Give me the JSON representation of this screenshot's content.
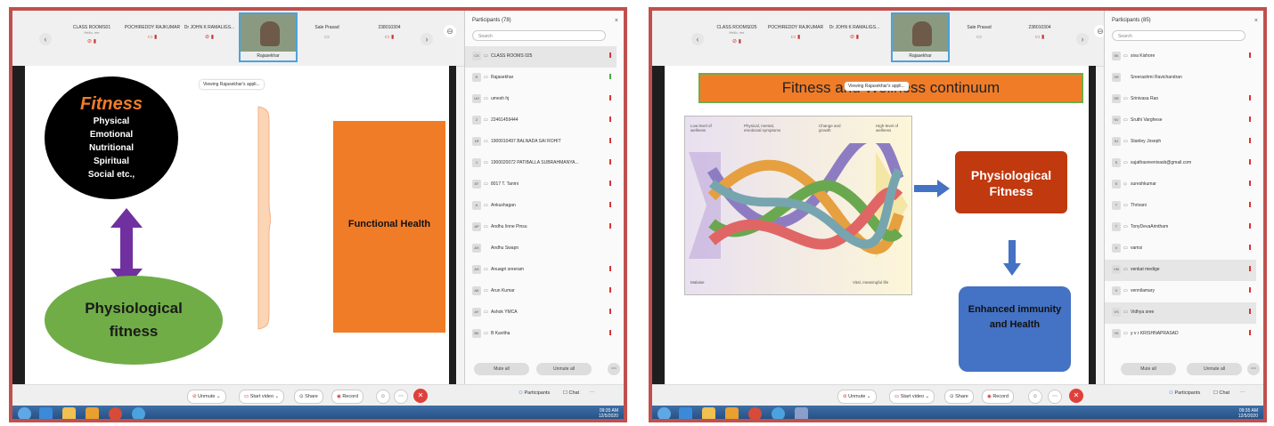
{
  "shot1": {
    "thumbnails": [
      {
        "name": "CLASS ROOMS01",
        "sub": "Hello, me",
        "icon": "mic-muted-icon"
      },
      {
        "name": "POCHIREDDY RAJKUMAR",
        "sub": "",
        "icon": "mic-muted-icon"
      },
      {
        "name": "Dr JOHN K RAMALIGS...",
        "sub": "",
        "icon": "mic-muted-icon"
      },
      {
        "name": "Sale Prasad",
        "sub": "",
        "icon": "mic-icon"
      },
      {
        "name": "238010304",
        "sub": "",
        "icon": "mic-muted-icon"
      }
    ],
    "active_speaker": "Rajasekhar",
    "viewing_text": "Viewing Rajasekhar's appli...",
    "slide": {
      "fitness_title": "Fitness",
      "fitness_items": [
        "Physical",
        "Emotional",
        "Nutritional",
        "Spiritual",
        "Social etc.,"
      ],
      "physiological": "Physiological fitness",
      "functional": "Functional  Health"
    },
    "participants": {
      "header": "Participants (78)",
      "search": "Search",
      "list": [
        {
          "initials": "CS",
          "name": "CLASS ROOMS 025"
        },
        {
          "initials": "R",
          "name": "Rajasekhar"
        },
        {
          "initials": "UH",
          "name": "umesh hj"
        },
        {
          "initials": "2",
          "name": "22461459444"
        },
        {
          "initials": "1R",
          "name": "1900010497 BALNADA SAI ROHIT"
        },
        {
          "initials": "1",
          "name": "1900020072 PATIBALLA SUBRAHMANYA..."
        },
        {
          "initials": "8T",
          "name": "8017 T. Tanmi"
        },
        {
          "initials": "A",
          "name": "Ankushagan"
        },
        {
          "initials": "AP",
          "name": "Andhu Iinne Pinsu"
        },
        {
          "initials": "AS",
          "name": "Andhu Swapn"
        },
        {
          "initials": "AS",
          "name": "Anuagri sreeram"
        },
        {
          "initials": "AK",
          "name": "Arun Kumar"
        },
        {
          "initials": "AY",
          "name": "Ashok YMCA"
        },
        {
          "initials": "BK",
          "name": "B Kavitha"
        }
      ],
      "mute_all": "Mute all",
      "unmute_all": "Unmute all"
    }
  },
  "shot2": {
    "thumbnails": [
      {
        "name": "CLASS ROOMS025",
        "sub": "Hello, me",
        "icon": "mic-muted-icon"
      },
      {
        "name": "POCHIREDDY RAJKUMAR",
        "sub": "",
        "icon": "mic-muted-icon"
      },
      {
        "name": "Dr JOHN K RAMALIGS...",
        "sub": "",
        "icon": "mic-muted-icon"
      },
      {
        "name": "Sale Prasad",
        "sub": "",
        "icon": "mic-icon"
      },
      {
        "name": "238010304",
        "sub": "",
        "icon": "mic-muted-icon"
      }
    ],
    "active_speaker": "Rajasekhar",
    "viewing_text": "Viewing Rajasekhar's appli...",
    "slide": {
      "title": "Fitness and Wellness continuum",
      "img_labels": [
        "Low level of wellness",
        "Physical, mental, emotional symptoms",
        "Change and growth",
        "High-level of wellness",
        "Malaise",
        "Vital, meaningful life"
      ],
      "physiological": "Physiological Fitness",
      "enhanced": "Enhanced immunity and Health"
    },
    "participants": {
      "header": "Participants (85)",
      "search": "Search",
      "list": [
        {
          "initials": "SK",
          "name": "siva Kishore"
        },
        {
          "initials": "SR",
          "name": "Sreerashmi Ravichandran"
        },
        {
          "initials": "SR",
          "name": "Srinivasa Rao"
        },
        {
          "initials": "SV",
          "name": "Sruthi Varghese"
        },
        {
          "initials": "SJ",
          "name": "Stanley Joseph"
        },
        {
          "initials": "S",
          "name": "sujathasreenivasb@gmail.com"
        },
        {
          "initials": "S",
          "name": "sureshkumar"
        },
        {
          "initials": "T",
          "name": "Thrivani"
        },
        {
          "initials": "T",
          "name": "TonyDevaArintham"
        },
        {
          "initials": "V",
          "name": "vamsi"
        },
        {
          "initials": "VM",
          "name": "venkat medige"
        },
        {
          "initials": "V",
          "name": "vennilamary"
        },
        {
          "initials": "VS",
          "name": "Vidhya sree"
        },
        {
          "initials": "YK",
          "name": "y v r KRISHNAPRASAD"
        }
      ],
      "mute_all": "Mute all",
      "unmute_all": "Unmute all"
    }
  },
  "controls": {
    "unmute": "Unmute",
    "start_video": "Start video",
    "share": "Share",
    "record": "Record",
    "participants": "Participants",
    "chat": "Chat"
  },
  "tray_time": "09:35 AM",
  "tray_date": "12/5/2020",
  "colors": {
    "frame": "#c0504d",
    "orange": "#f07c28",
    "green": "#70ad47",
    "blue": "#4472c4",
    "red": "#c0390f"
  }
}
